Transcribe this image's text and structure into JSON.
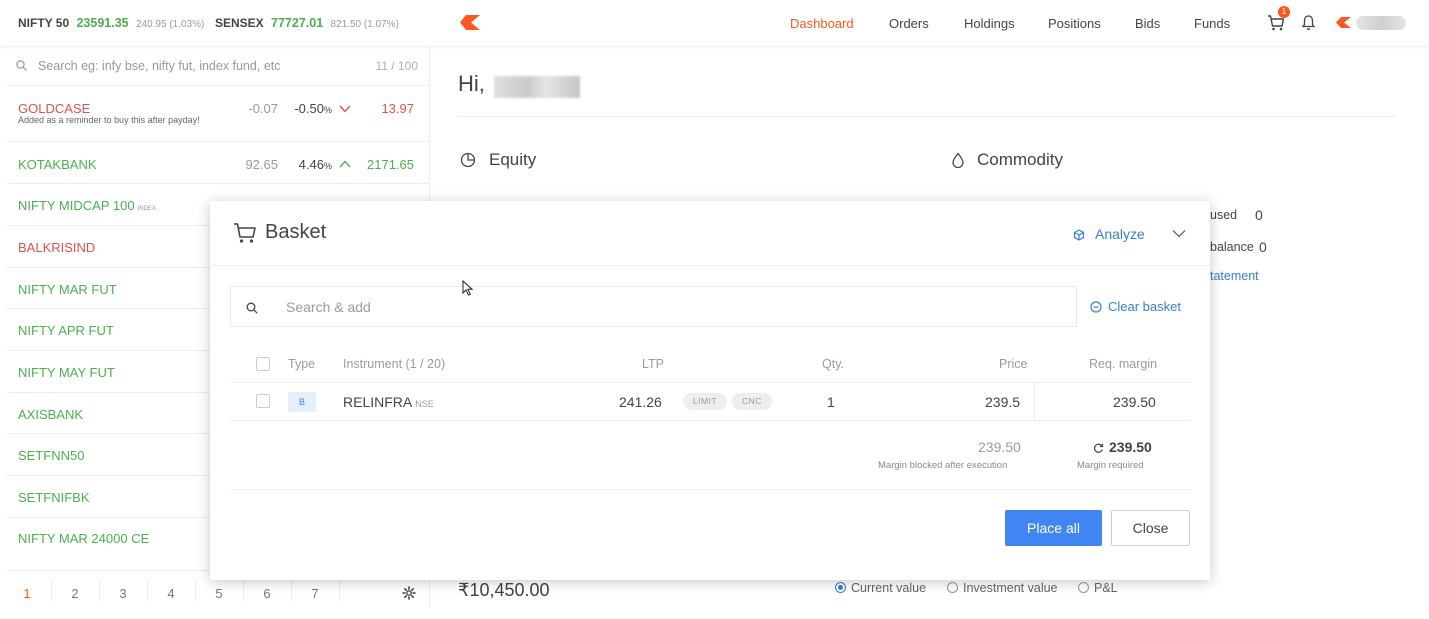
{
  "topbar": {
    "indices": [
      {
        "name": "NIFTY 50",
        "value": "23591.35",
        "change": "240.95 (1.03%)"
      },
      {
        "name": "SENSEX",
        "value": "77727.01",
        "change": "821.50 (1.07%)"
      }
    ],
    "nav": [
      "Dashboard",
      "Orders",
      "Holdings",
      "Positions",
      "Bids",
      "Funds"
    ],
    "cart_count": "1"
  },
  "marketwatch": {
    "search_placeholder": "Search eg: infy bse, nifty fut, index fund, etc",
    "count": "11 / 100",
    "items": [
      {
        "name": "GOLDCASE",
        "color": "red",
        "note": "Added as a reminder to buy this after payday!",
        "change": "-0.07",
        "pct": "-0.50",
        "pct_unit": "%",
        "direction": "down",
        "ltp": "13.97"
      },
      {
        "name": "KOTAKBANK",
        "color": "green",
        "change": "92.65",
        "pct": "4.46",
        "pct_unit": "%",
        "direction": "up",
        "ltp": "2171.65"
      },
      {
        "name": "NIFTY MIDCAP 100",
        "color": "green",
        "tag": "INDEX"
      },
      {
        "name": "BALKRISIND",
        "color": "red"
      },
      {
        "name": "NIFTY MAR FUT",
        "color": "green"
      },
      {
        "name": "NIFTY APR FUT",
        "color": "green"
      },
      {
        "name": "NIFTY MAY FUT",
        "color": "green"
      },
      {
        "name": "AXISBANK",
        "color": "green"
      },
      {
        "name": "SETFNN50",
        "color": "green"
      },
      {
        "name": "SETFNIFBK",
        "color": "green"
      },
      {
        "name": "NIFTY MAR 24000 CE",
        "color": "green"
      }
    ],
    "pages": [
      "1",
      "2",
      "3",
      "4",
      "5",
      "6",
      "7"
    ]
  },
  "dashboard": {
    "greeting": "Hi,",
    "equity_title": "Equity",
    "commodity_title": "Commodity",
    "margin_used_label": "used",
    "margin_used_value": "0",
    "opening_balance_label": "balance",
    "opening_balance_value": "0",
    "statement_link": "tatement",
    "holdings_value": "₹10,450.00",
    "radios": [
      "Current value",
      "Investment value",
      "P&L"
    ]
  },
  "basket": {
    "title": "Basket",
    "analyze": "Analyze",
    "search_placeholder": "Search & add",
    "clear": "Clear basket",
    "headers": {
      "type": "Type",
      "instrument": "Instrument (1 / 20)",
      "ltp": "LTP",
      "qty": "Qty.",
      "price": "Price",
      "margin": "Req. margin"
    },
    "row": {
      "type": "B",
      "instrument": "RELINFRA",
      "exchange": "NSE",
      "ltp": "241.26",
      "order_type": "LIMIT",
      "product": "CNC",
      "qty": "1",
      "price": "239.5",
      "margin": "239.50"
    },
    "summary": {
      "blocked_value": "239.50",
      "blocked_label": "Margin blocked after execution",
      "required_value": "239.50",
      "required_label": "Margin required"
    },
    "place_all": "Place all",
    "close": "Close"
  },
  "colors": {
    "accent": "#ff5722",
    "primary": "#4184f3",
    "link": "#387ed1",
    "up": "#4caf50",
    "down": "#df514c"
  }
}
